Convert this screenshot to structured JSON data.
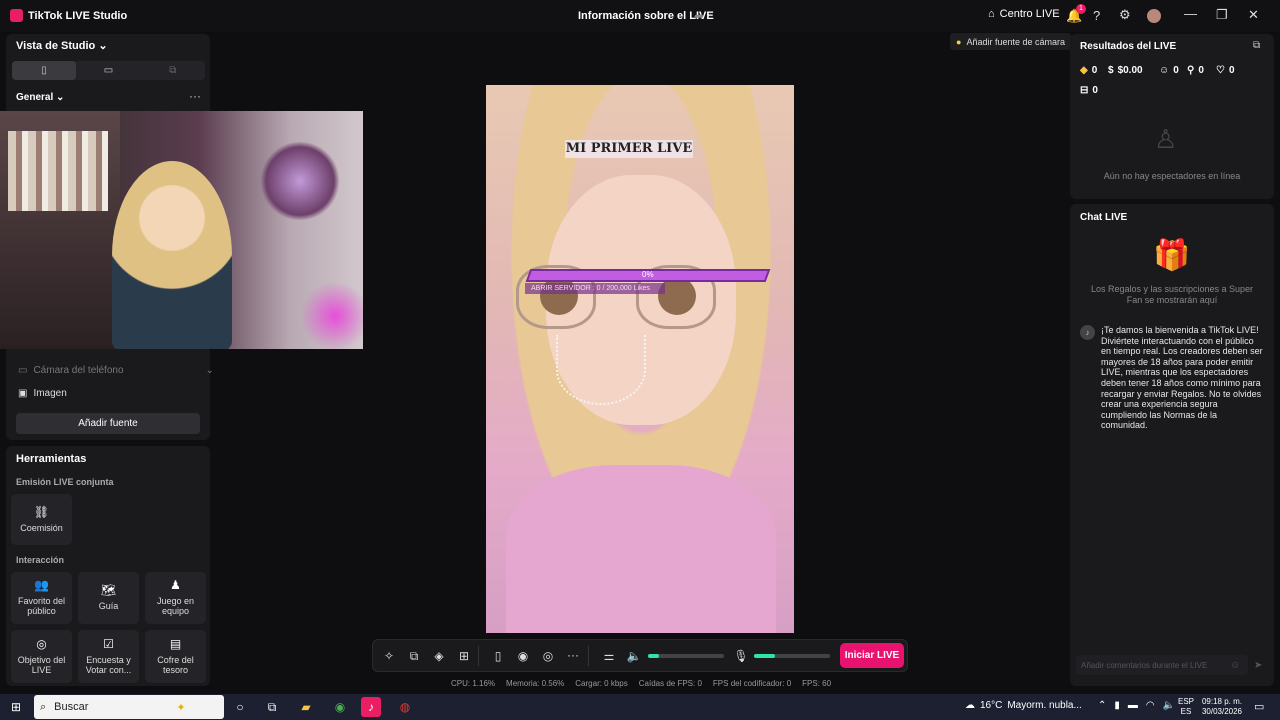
{
  "titlebar": {
    "app_name": "TikTok LIVE Studio",
    "center_title": "Información sobre el LIVE",
    "centro_live": "Centro LIVE",
    "notif_count": "1"
  },
  "left": {
    "vista": "Vista de Studio",
    "orientations": [
      "vertical",
      "horizontal",
      "dual"
    ],
    "general": "General",
    "camara_telefono": "Cámara del teléfono",
    "imagen": "Imagen",
    "add_source": "Añadir fuente"
  },
  "tools": {
    "title": "Herramientas",
    "emision_section": "Emisión LIVE conjunta",
    "coemision": "Coemisión",
    "interaccion_section": "Interacción",
    "favorito": "Favorito del público",
    "guia": "Guía",
    "juego": "Juego en equipo",
    "objetivo": "Objetivo del LIVE",
    "encuesta": "Encuesta y Votar con...",
    "cofre": "Cofre del tesoro"
  },
  "stage": {
    "overlay_title": "MI PRIMER LIVE",
    "progress_pct": "0%",
    "progress_value": 0,
    "progress_label": "ABRIR SERVIDOR : 0 / 200,000 Likes"
  },
  "controls": {
    "start_button": "Iniciar LIVE",
    "volume_level": 0.15,
    "mic_level": 0.28
  },
  "stats": {
    "cpu": "CPU:  1.16%",
    "memoria": "Memoria:  0.56%",
    "cargar": "Cargar:  0 kbps",
    "caidas": "Caídas de FPS:  0",
    "fps_cod": "FPS del codificador:  0",
    "fps": "FPS:  60"
  },
  "right": {
    "add_camera": "Añadir fuente de cámara",
    "results_title": "Resultados del LIVE",
    "diamonds": "0",
    "money": "$0.00",
    "viewers": "0",
    "followers": "0",
    "likes": "0",
    "gifts": "0",
    "no_viewers": "Aún no hay espectadores en línea",
    "chat_title": "Chat LIVE",
    "gifts_note": "Los Regalos y las suscripciones a Super Fan se mostrarán aquí",
    "welcome_msg": "¡Te damos la bienvenida a TikTok LIVE! Diviértete interactuando con el público en tiempo real. Los creadores deben ser mayores de 18 años para poder emitir LIVE, mientras que los espectadores deben tener 18 años como mínimo para recargar y enviar Regalos. No te olvides crear una experiencia segura cumpliendo las Normas de la comunidad.",
    "comment_placeholder": "Añadir comentarios durante el LIVE"
  },
  "taskbar": {
    "search": "Buscar",
    "temp": "16°C",
    "weather": "Mayorm. nubla...",
    "lang1": "ESP",
    "lang2": "ES",
    "time": "09:18 p. m.",
    "date": "30/03/2026"
  },
  "colors": {
    "accent": "#e8126f",
    "meter": "#2ee6a5",
    "bar": "#c05de0"
  }
}
